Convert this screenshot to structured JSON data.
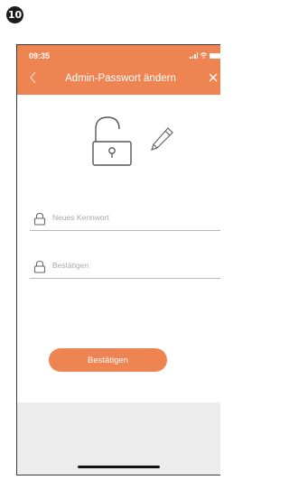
{
  "step": {
    "number": "10"
  },
  "status_bar": {
    "time": "09:35"
  },
  "nav": {
    "title": "Admin-Passwort ändern"
  },
  "form": {
    "new_password": {
      "placeholder": "Neues Kennwort",
      "value": ""
    },
    "confirm_password": {
      "placeholder": "Bestätigen",
      "value": ""
    }
  },
  "actions": {
    "confirm_label": "Bestätigen"
  },
  "colors": {
    "accent": "#ee8452",
    "footer": "#ececec",
    "badge": "#1a1a1a"
  },
  "icons": {
    "back": "chevron-left-icon",
    "close": "close-icon",
    "lock": "unlocked-padlock-icon",
    "edit": "pencil-icon",
    "field_lock": "lock-icon",
    "visibility": "eye-icon"
  }
}
